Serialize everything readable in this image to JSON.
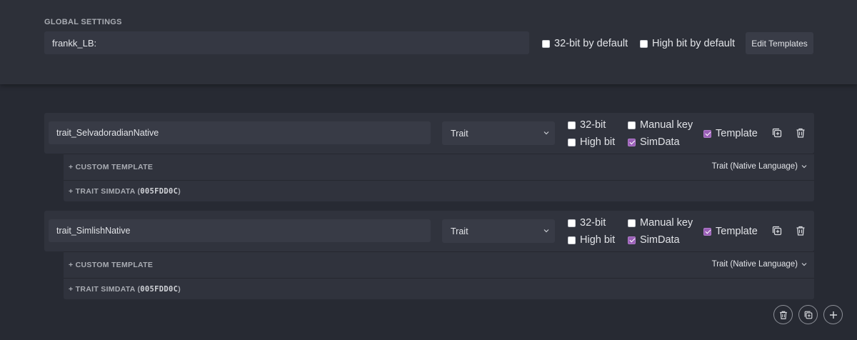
{
  "global": {
    "title": "GLOBAL SETTINGS",
    "prefix_value": "frankk_LB:",
    "opt_32bit": {
      "label": "32-bit by default",
      "checked": false
    },
    "opt_highbit": {
      "label": "High bit by default",
      "checked": false
    },
    "edit_templates_label": "Edit Templates"
  },
  "entries": [
    {
      "name": "trait_SelvadoradianNative",
      "type": "Trait",
      "bit32": {
        "label": "32-bit",
        "checked": false
      },
      "manual_key": {
        "label": "Manual key",
        "checked": false
      },
      "high_bit": {
        "label": "High bit",
        "checked": false
      },
      "simdata": {
        "label": "SimData",
        "checked": true
      },
      "template": {
        "label": "Template",
        "checked": true
      },
      "custom_template_label": "+ CUSTOM TEMPLATE",
      "template_select": "Trait (Native Language)",
      "simdata_label": "+ TRAIT SIMDATA (",
      "simdata_hex": "005FDD0C",
      "simdata_close": ")"
    },
    {
      "name": "trait_SimlishNative",
      "type": "Trait",
      "bit32": {
        "label": "32-bit",
        "checked": false
      },
      "manual_key": {
        "label": "Manual key",
        "checked": false
      },
      "high_bit": {
        "label": "High bit",
        "checked": false
      },
      "simdata": {
        "label": "SimData",
        "checked": true
      },
      "template": {
        "label": "Template",
        "checked": true
      },
      "custom_template_label": "+ CUSTOM TEMPLATE",
      "template_select": "Trait (Native Language)",
      "simdata_label": "+ TRAIT SIMDATA (",
      "simdata_hex": "005FDD0C",
      "simdata_close": ")"
    }
  ],
  "icons": {
    "duplicate": "duplicate-icon",
    "delete": "trash-icon",
    "add": "plus-icon",
    "chevron": "chevron-down-icon"
  },
  "colors": {
    "background": "#272a33",
    "panel": "#2d3039",
    "accent": "#9a5fb7"
  }
}
